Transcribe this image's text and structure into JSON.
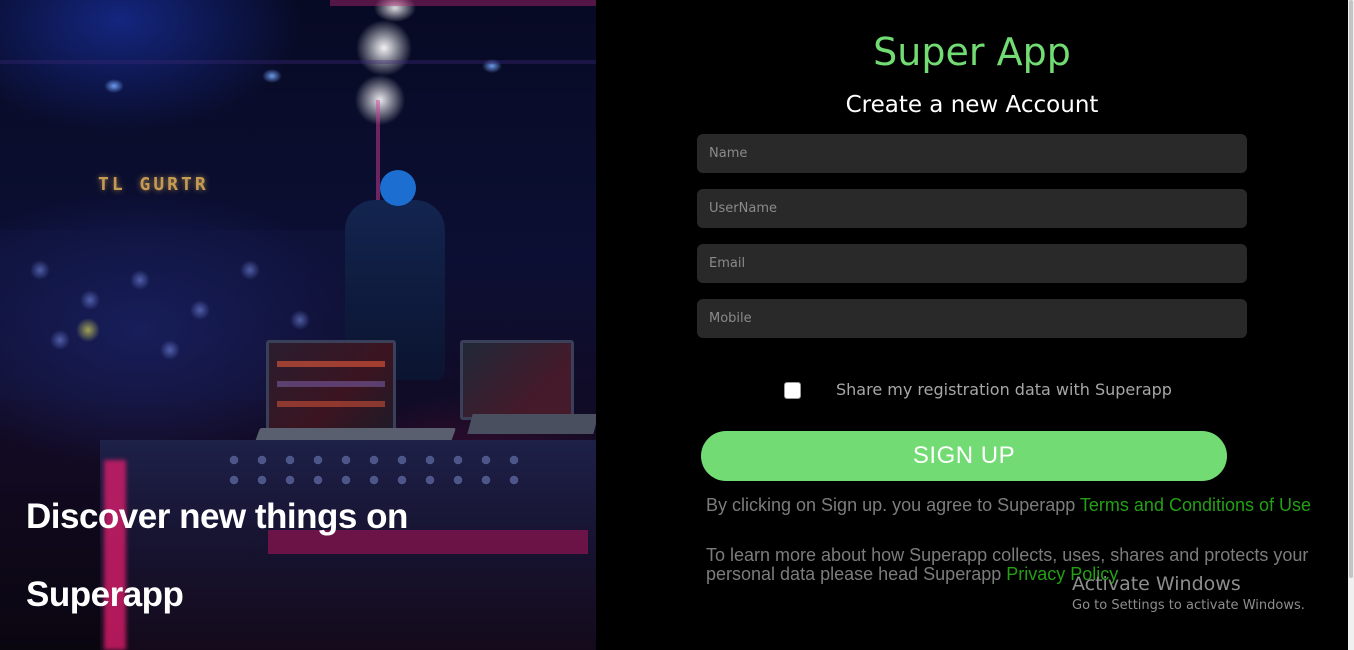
{
  "hero": {
    "line1": "Discover new things on",
    "line2": "Superapp",
    "marquee": "TL GURTR"
  },
  "form": {
    "logo": "Super App",
    "heading": "Create a new Account",
    "name_placeholder": "Name",
    "username_placeholder": "UserName",
    "email_placeholder": "Email",
    "mobile_placeholder": "Mobile",
    "share_label": "Share my registration data with Superapp",
    "share_checked": false,
    "signup_label": "SIGN UP",
    "terms_prefix": "By clicking on Sign up. you agree to Superapp ",
    "terms_link": "Terms and Conditions of Use",
    "privacy_prefix": "To learn more about how Superapp collects, uses, shares and protects your personal data please head Superapp ",
    "privacy_link": "Privacy Policy"
  },
  "watermark": {
    "title": "Activate Windows",
    "subtitle": "Go to Settings to activate Windows."
  },
  "colors": {
    "accent": "#72db73",
    "link": "#23a014",
    "input_bg": "#292929"
  }
}
